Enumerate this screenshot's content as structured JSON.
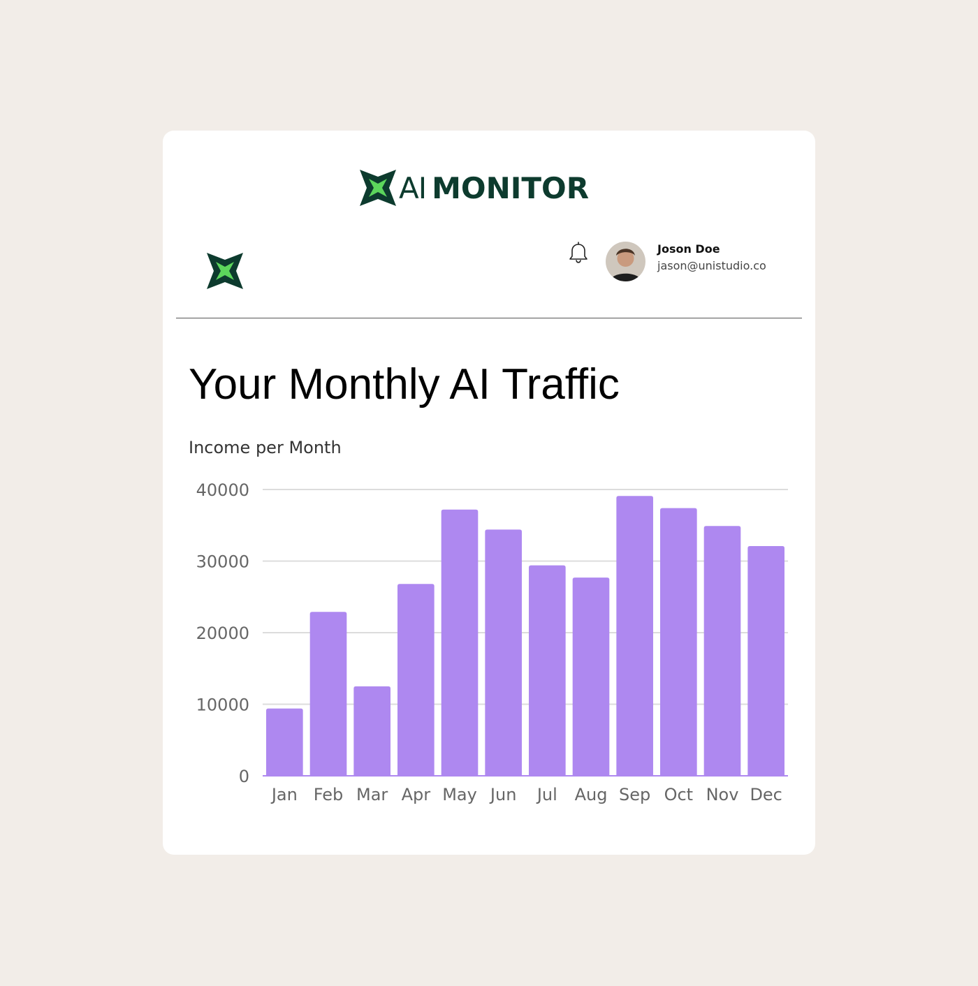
{
  "brand": {
    "name_light": "AI",
    "name_bold": "MONITOR",
    "accent_color": "#5cd65c",
    "dark_color": "#0d3b2e"
  },
  "header": {
    "notification_icon": "bell-icon",
    "user": {
      "name": "Joson Doe",
      "email": "jason@unistudio.co"
    }
  },
  "page": {
    "title": "Your Monthly AI Traffic"
  },
  "chart_data": {
    "type": "bar",
    "title": "Income per Month",
    "xlabel": "",
    "ylabel": "",
    "categories": [
      "Jan",
      "Feb",
      "Mar",
      "Apr",
      "May",
      "Jun",
      "Jul",
      "Aug",
      "Sep",
      "Oct",
      "Nov",
      "Dec"
    ],
    "values": [
      9400,
      22900,
      12500,
      26800,
      37200,
      34400,
      29400,
      27700,
      39100,
      37400,
      34900,
      32100
    ],
    "ylim": [
      0,
      40000
    ],
    "yticks": [
      "0",
      "10000",
      "20000",
      "30000",
      "40000"
    ],
    "grid": true,
    "bar_color": "#ae88f0"
  }
}
